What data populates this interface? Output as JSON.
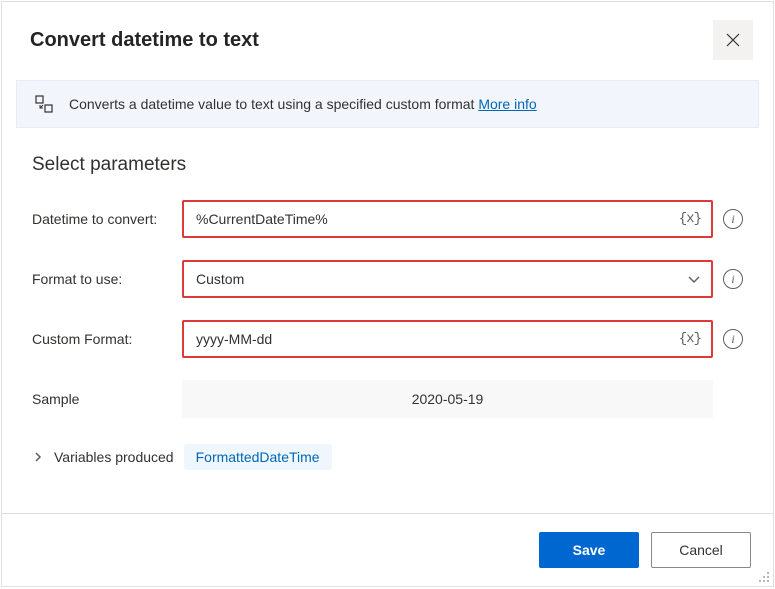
{
  "header": {
    "title": "Convert datetime to text"
  },
  "banner": {
    "text": "Converts a datetime value to text using a specified custom format ",
    "link": "More info"
  },
  "section": {
    "title": "Select parameters"
  },
  "fields": {
    "datetime": {
      "label": "Datetime to convert:",
      "value": "%CurrentDateTime%"
    },
    "format": {
      "label": "Format to use:",
      "value": "Custom"
    },
    "custom": {
      "label": "Custom Format:",
      "value": "yyyy-MM-dd"
    },
    "sample": {
      "label": "Sample",
      "value": "2020-05-19"
    }
  },
  "variables": {
    "label": "Variables produced",
    "badge": "FormattedDateTime"
  },
  "footer": {
    "save": "Save",
    "cancel": "Cancel"
  },
  "glyphs": {
    "varToken": "{x}"
  }
}
